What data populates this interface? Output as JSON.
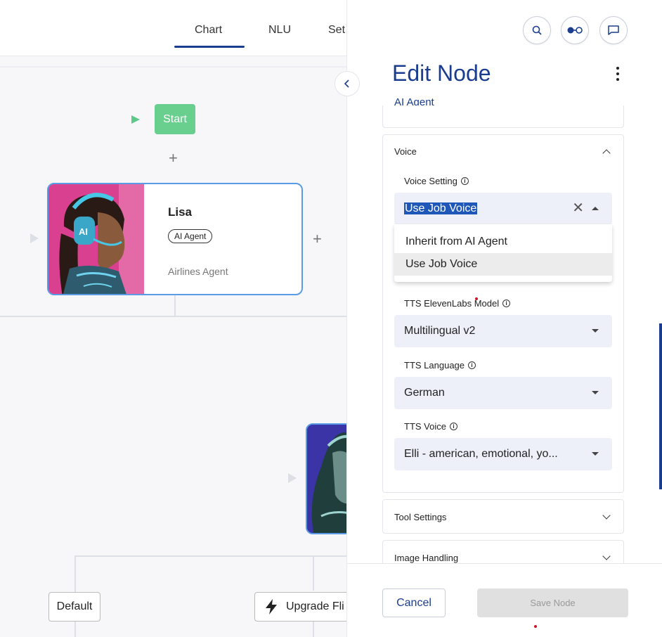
{
  "tabs": [
    {
      "label": "Chart"
    },
    {
      "label": "NLU"
    },
    {
      "label": "Set"
    }
  ],
  "canvas": {
    "start_label": "Start",
    "agent": {
      "name": "Lisa",
      "badge": "AI Agent",
      "subtitle": "Airlines Agent",
      "avatar_text": "AI"
    },
    "bottom_buttons": {
      "default_label": "Default",
      "upgrade_label": "Upgrade Fli"
    }
  },
  "panel": {
    "title": "Edit Node",
    "subtitle": "AI Agent",
    "voice_section": {
      "title": "Voice",
      "voice_setting": {
        "label": "Voice Setting",
        "value": "Use Job Voice",
        "options": [
          "Inherit from AI Agent",
          "Use Job Voice"
        ]
      },
      "model": {
        "label": "TTS ElevenLabs Model",
        "value": "Multilingual v2"
      },
      "language": {
        "label": "TTS Language",
        "value": "German"
      },
      "voice": {
        "label": "TTS Voice",
        "value": "Elli - american, emotional, yo..."
      }
    },
    "tool_settings_title": "Tool Settings",
    "image_handling_title": "Image Handling",
    "footer": {
      "cancel_label": "Cancel",
      "save_label": "Save Node"
    }
  },
  "colors": {
    "brand": "#1a3d8f",
    "start_node": "#68cf8f",
    "card_border": "#5b9be6"
  },
  "icons": [
    "search-icon",
    "toggle-icon",
    "chat-icon",
    "chevron-left-icon",
    "kebab-menu-icon",
    "info-icon",
    "bolt-icon"
  ]
}
